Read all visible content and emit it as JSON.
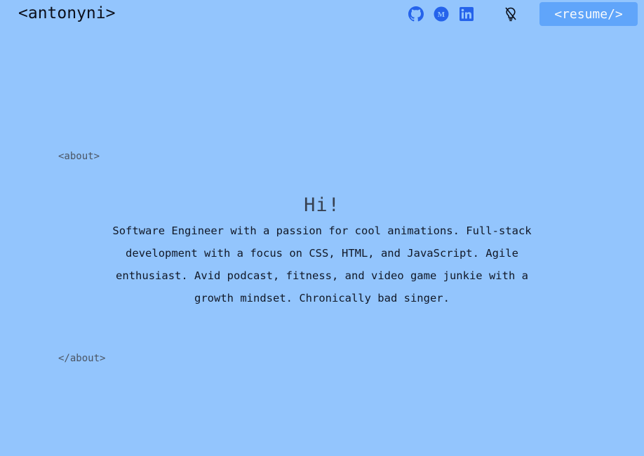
{
  "header": {
    "logo_text": "<antonyni>",
    "icons": [
      {
        "name": "github-icon",
        "color": "#2563eb"
      },
      {
        "name": "medium-icon",
        "color": "#2563eb"
      },
      {
        "name": "linkedin-icon",
        "color": "#2563eb"
      },
      {
        "name": "lightbulb-icon",
        "color": "#0b0f1a"
      }
    ],
    "resume_label": "<resume/>"
  },
  "about": {
    "open_tag": "<about>",
    "greeting": "Hi!",
    "bio": "Software Engineer with a passion for cool animations. Full-stack development with a focus on CSS, HTML, and JavaScript. Agile enthusiast. Avid podcast, fitness, and video game junkie with a growth mindset. Chronically bad singer.",
    "close_tag": "</about>"
  },
  "colors": {
    "background": "#93c5fd",
    "accent": "#60a5fa",
    "icon": "#2563eb"
  }
}
